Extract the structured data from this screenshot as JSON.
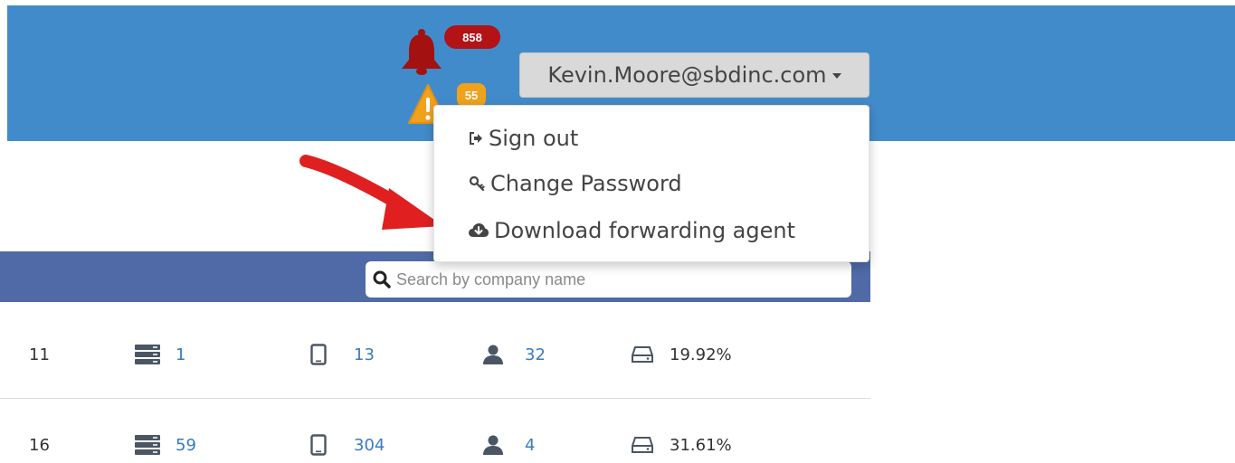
{
  "header": {
    "alerts_count": "858",
    "warnings_count": "55",
    "user_email": "Kevin.Moore@sbdinc.com"
  },
  "user_menu": {
    "items": [
      {
        "label": "Sign out",
        "icon": "sign-out-icon"
      },
      {
        "label": "Change Password",
        "icon": "key-icon"
      },
      {
        "label": "Download forwarding agent",
        "icon": "cloud-download-icon"
      }
    ]
  },
  "search": {
    "placeholder": "Search by company name",
    "value": ""
  },
  "rows": [
    {
      "count": "11",
      "servers": "1",
      "devices": "13",
      "users": "32",
      "disk": "19.92%"
    },
    {
      "count": "16",
      "servers": "59",
      "devices": "304",
      "users": "4",
      "disk": "31.61%"
    }
  ],
  "colors": {
    "header_bg": "#428bca",
    "search_bar_bg": "#4f6aa7",
    "alert_badge": "#b31217",
    "warning_badge": "#f0a21d",
    "link": "#3a7abf",
    "annotation_arrow": "#e02020"
  },
  "icons": {
    "bell": "bell-icon",
    "warning": "warning-triangle-icon",
    "search": "search-icon",
    "server": "server-icon",
    "device": "tablet-icon",
    "user": "user-icon",
    "disk": "hard-drive-icon"
  }
}
